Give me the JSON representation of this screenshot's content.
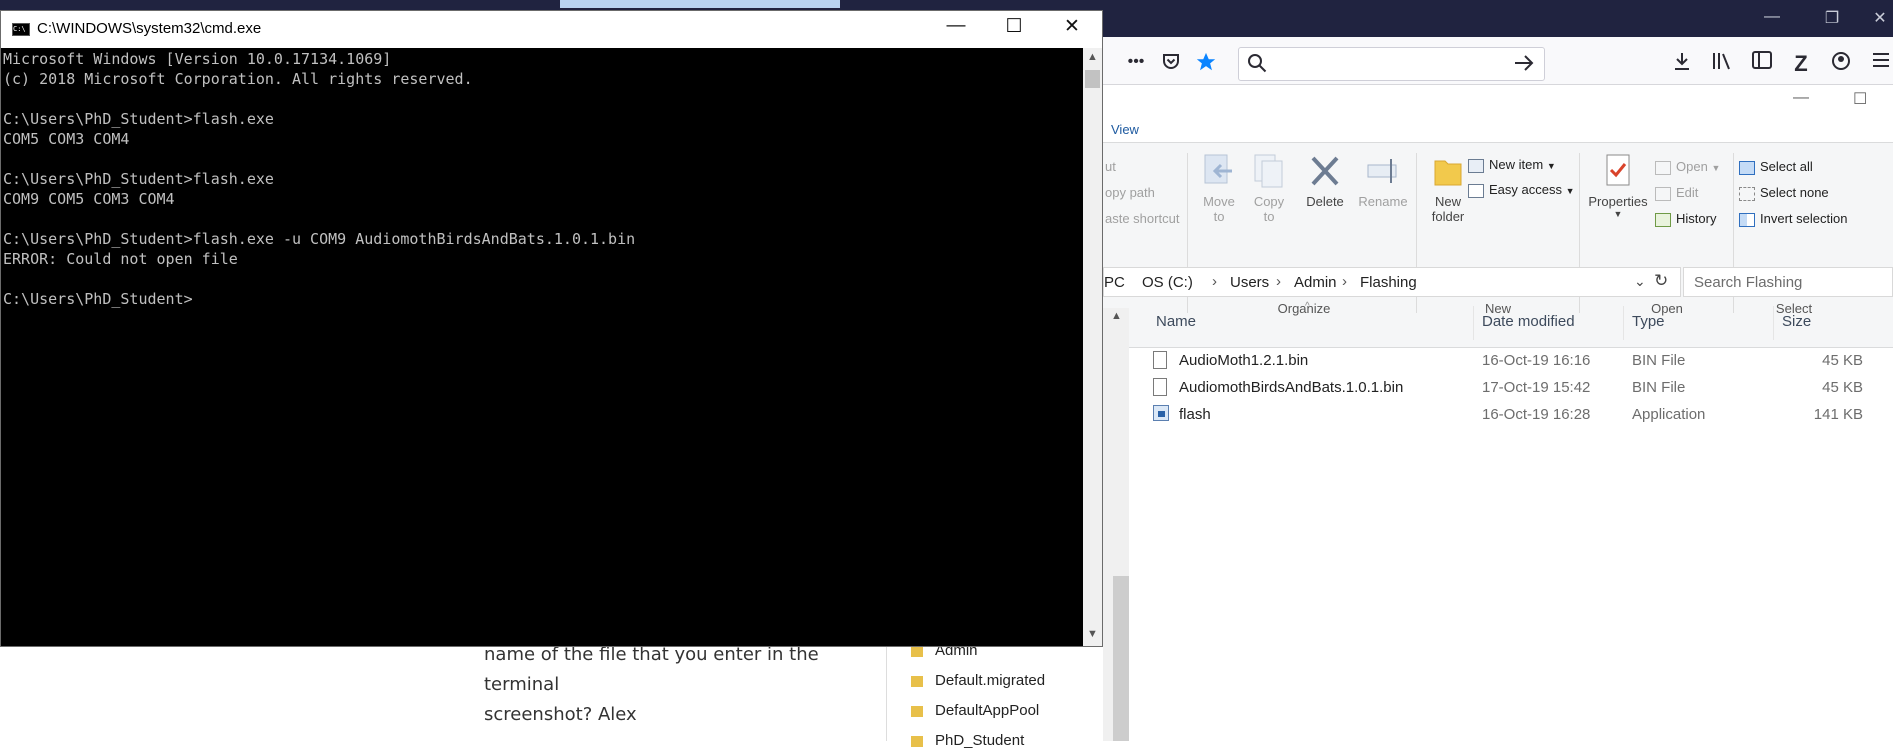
{
  "browser": {
    "search_icon": "search-icon",
    "go_icon": "arrow-right-icon",
    "overflow_label": "•••",
    "minimize_label": "—",
    "restore_label": "❐",
    "close_label": "✕"
  },
  "page": {
    "line1": "name of the file that you enter in the terminal",
    "line2": "screenshot? Alex"
  },
  "tree": {
    "items": [
      "Admin",
      "Default.migrated",
      "DefaultAppPool",
      "PhD_Student"
    ]
  },
  "explorer": {
    "minimize_label": "—",
    "maximize_label": "☐",
    "view_tab": "View",
    "ribbon": {
      "cut_fragment": "ut",
      "copy_path_fragment": "opy path",
      "paste_shortcut_fragment": "aste shortcut",
      "move_to": "Move",
      "move_to_2": "to",
      "copy_to": "Copy",
      "copy_to_2": "to",
      "delete": "Delete",
      "rename": "Rename",
      "new_folder": "New",
      "new_folder_2": "folder",
      "new_item": "New item",
      "easy_access": "Easy access",
      "properties": "Properties",
      "open": "Open",
      "edit": "Edit",
      "history": "History",
      "select_all": "Select all",
      "select_none": "Select none",
      "invert_selection": "Invert selection",
      "group_organize": "Organize",
      "group_new": "New",
      "group_open": "Open",
      "group_select": "Select"
    },
    "breadcrumb": [
      "PC",
      "OS (C:)",
      "Users",
      "Admin",
      "Flashing"
    ],
    "search_placeholder": "Search Flashing",
    "columns": {
      "name": "Name",
      "date": "Date modified",
      "type": "Type",
      "size": "Size"
    },
    "files": [
      {
        "name": "AudioMoth1.2.1.bin",
        "date": "16-Oct-19 16:16",
        "type": "BIN File",
        "size": "45 KB",
        "icon": "document-icon"
      },
      {
        "name": "AudiomothBirdsAndBats.1.0.1.bin",
        "date": "17-Oct-19 15:42",
        "type": "BIN File",
        "size": "45 KB",
        "icon": "document-icon"
      },
      {
        "name": "flash",
        "date": "16-Oct-19 16:28",
        "type": "Application",
        "size": "141 KB",
        "icon": "application-icon"
      }
    ]
  },
  "cmd": {
    "title": "C:\\WINDOWS\\system32\\cmd.exe",
    "icon_text": "C:\\",
    "minimize_label": "—",
    "maximize_label": "☐",
    "close_label": "✕",
    "lines": [
      "Microsoft Windows [Version 10.0.17134.1069]",
      "(c) 2018 Microsoft Corporation. All rights reserved.",
      "",
      "C:\\Users\\PhD_Student>flash.exe",
      "COM5 COM3 COM4",
      "",
      "C:\\Users\\PhD_Student>flash.exe",
      "COM9 COM5 COM3 COM4",
      "",
      "C:\\Users\\PhD_Student>flash.exe -u COM9 AudiomothBirdsAndBats.1.0.1.bin",
      "ERROR: Could not open file",
      "",
      "C:\\Users\\PhD_Student>"
    ]
  }
}
